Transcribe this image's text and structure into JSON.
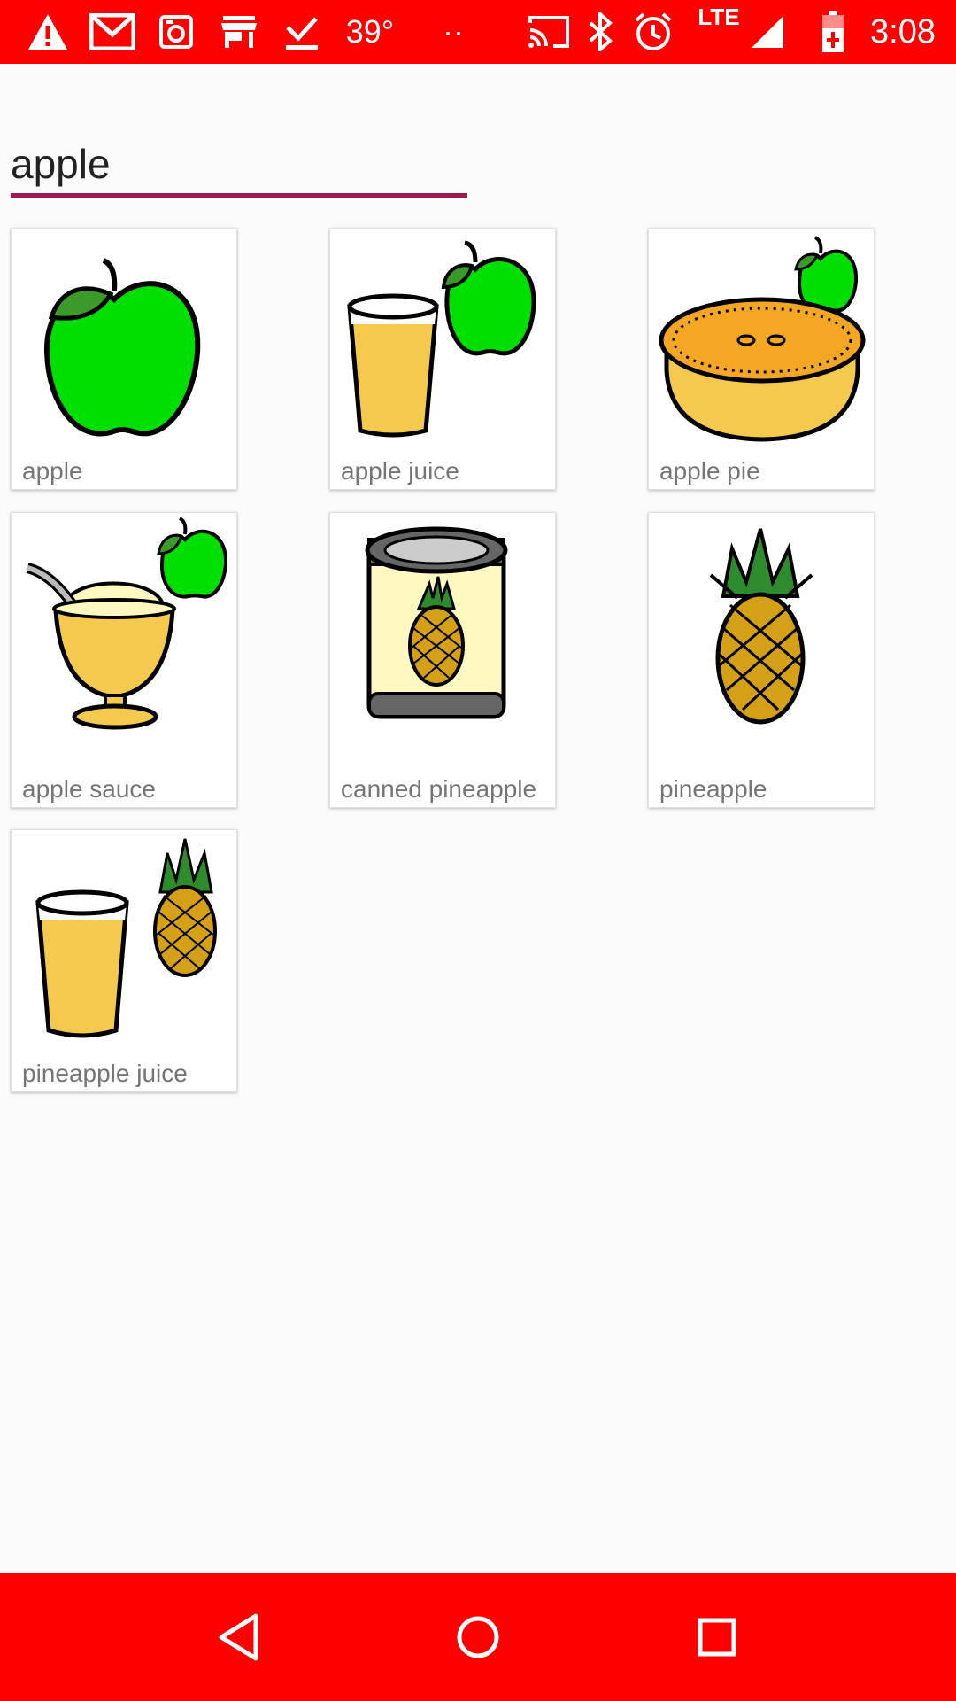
{
  "status_bar": {
    "temperature": "39°",
    "more": "··",
    "network": "LTE",
    "time": "3:08",
    "icons": [
      "warning-icon",
      "gmail-icon",
      "camera-icon",
      "store-icon",
      "download-done-icon",
      "cast-icon",
      "bluetooth-icon",
      "alarm-icon",
      "signal-icon",
      "battery-charging-icon"
    ]
  },
  "search": {
    "value": "apple"
  },
  "results": [
    {
      "label": "apple",
      "icon": "apple-icon"
    },
    {
      "label": "apple juice",
      "icon": "apple-juice-icon"
    },
    {
      "label": "apple pie",
      "icon": "apple-pie-icon"
    },
    {
      "label": "apple sauce",
      "icon": "apple-sauce-icon"
    },
    {
      "label": "canned pineapple",
      "icon": "canned-pineapple-icon"
    },
    {
      "label": "pineapple",
      "icon": "pineapple-icon"
    },
    {
      "label": "pineapple juice",
      "icon": "pineapple-juice-icon"
    }
  ],
  "nav_bar": {
    "icons": [
      "back-icon",
      "home-icon",
      "recents-icon"
    ]
  },
  "colors": {
    "system_bar": "#ff0000",
    "search_underline": "#9c1a4f",
    "apple_green": "#00e000",
    "juice_yellow": "#f5c94d"
  }
}
